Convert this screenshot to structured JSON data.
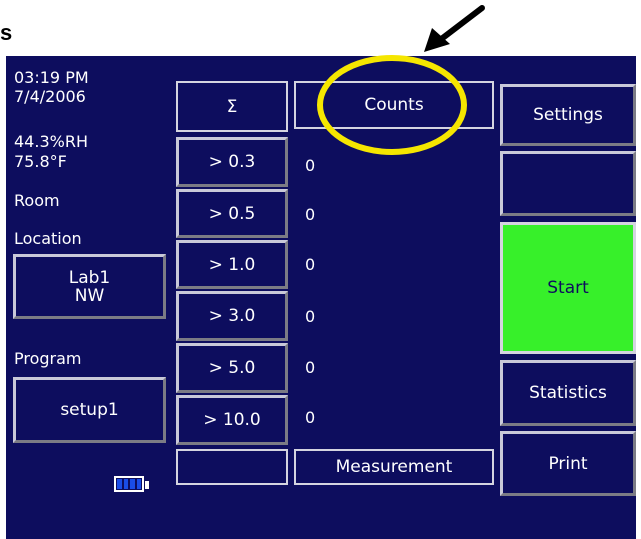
{
  "fragment_label": "s",
  "status": {
    "time": "03:19 PM",
    "date": "7/4/2006",
    "humidity": "44.3%RH",
    "temperature": "75.8°F"
  },
  "location": {
    "room_label": "Room",
    "location_label": "Location",
    "location_line1": "Lab1",
    "location_line2": "NW"
  },
  "program": {
    "label": "Program",
    "value": "setup1"
  },
  "battery": {
    "level_fraction": 1.0
  },
  "table": {
    "sum_header": "Σ",
    "counts_header": "Counts",
    "rows": [
      {
        "size": "> 0.3",
        "count": "0"
      },
      {
        "size": "> 0.5",
        "count": "0"
      },
      {
        "size": "> 1.0",
        "count": "0"
      },
      {
        "size": "> 3.0",
        "count": "0"
      },
      {
        "size": "> 5.0",
        "count": "0"
      },
      {
        "size": "> 10.0",
        "count": "0"
      }
    ],
    "measurement_label": "Measurement"
  },
  "right_buttons": {
    "settings": "Settings",
    "start": "Start",
    "statistics": "Statistics",
    "print": "Print"
  },
  "colors": {
    "screen_bg": "#0d0d5e",
    "start_green": "#37f02a",
    "highlight_yellow": "#f5e600",
    "battery_blue": "#1a4de8"
  }
}
